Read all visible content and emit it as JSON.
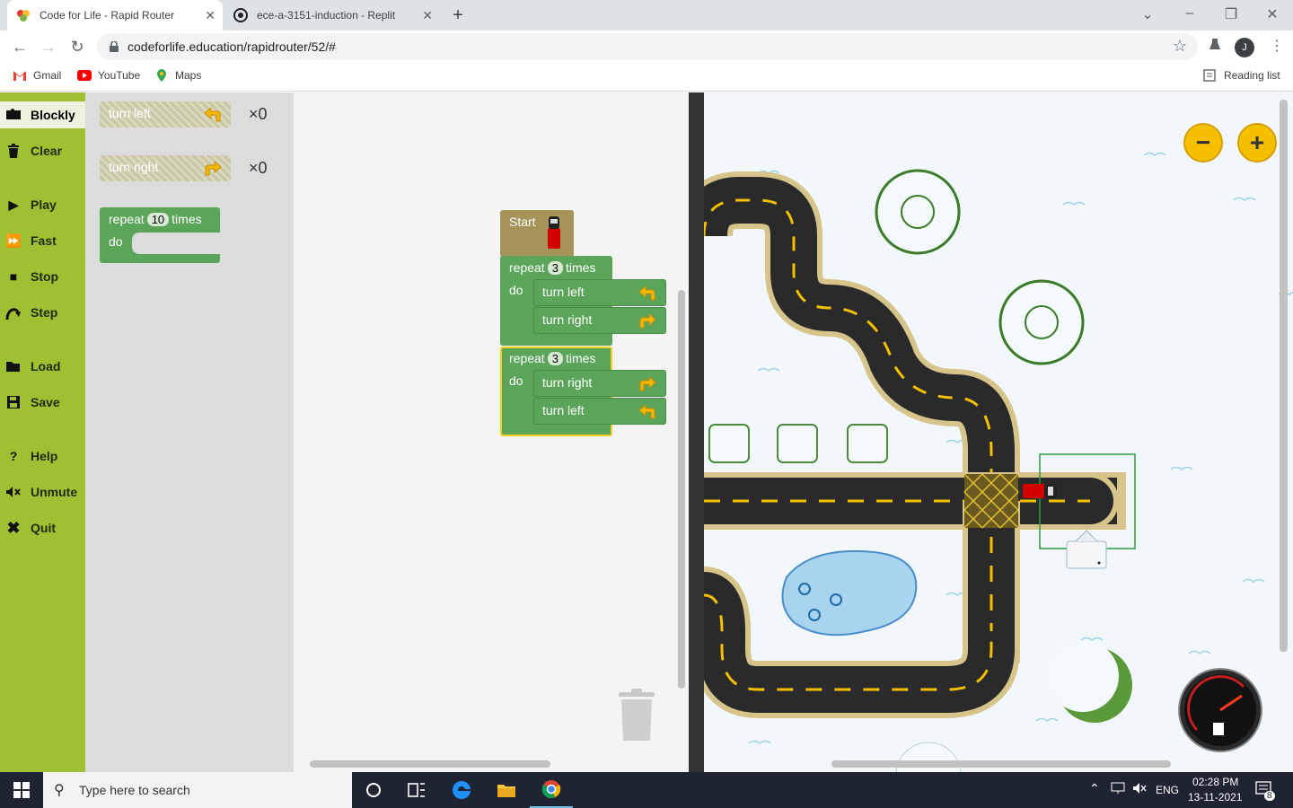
{
  "browser": {
    "tabs": [
      {
        "title": "Code for Life - Rapid Router",
        "active": true
      },
      {
        "title": "ece-a-3151-induction - Replit",
        "active": false
      }
    ],
    "url": "codeforlife.education/rapidrouter/52/#",
    "avatar_letter": "J",
    "bookmarks": [
      "Gmail",
      "YouTube",
      "Maps"
    ],
    "reading_list": "Reading list"
  },
  "sidebar": {
    "items": [
      {
        "label": "Blockly",
        "icon": "puzzle-icon",
        "active": true
      },
      {
        "label": "Clear",
        "icon": "trash-icon"
      },
      {
        "label": "Play",
        "icon": "play-icon"
      },
      {
        "label": "Fast",
        "icon": "fast-forward-icon"
      },
      {
        "label": "Stop",
        "icon": "stop-icon"
      },
      {
        "label": "Step",
        "icon": "step-icon"
      },
      {
        "label": "Load",
        "icon": "folder-icon"
      },
      {
        "label": "Save",
        "icon": "save-icon"
      },
      {
        "label": "Help",
        "icon": "help-icon"
      },
      {
        "label": "Unmute",
        "icon": "speaker-muted-icon"
      },
      {
        "label": "Quit",
        "icon": "close-icon"
      }
    ]
  },
  "toolbox": {
    "turn_left": {
      "label": "turn left",
      "count": "×0"
    },
    "turn_right": {
      "label": "turn right",
      "count": "×0"
    },
    "repeat": {
      "label": "repeat",
      "value": "10",
      "suffix": "times",
      "do": "do"
    }
  },
  "workspace": {
    "start": {
      "label": "Start"
    },
    "repeat1": {
      "label": "repeat",
      "value": "3",
      "suffix": "times",
      "do": "do",
      "cmd1": "turn left",
      "cmd2": "turn right"
    },
    "repeat2": {
      "label": "repeat",
      "value": "3",
      "suffix": "times",
      "do": "do",
      "cmd1": "turn right",
      "cmd2": "turn left"
    }
  },
  "colors": {
    "sidebar": "#a0c034",
    "block_green": "#5ba55b",
    "block_disabled": "#c9c8a6",
    "start_block": "#a6945a",
    "zoom_button": "#f5c000"
  },
  "taskbar": {
    "search_placeholder": "Type here to search",
    "lang": "ENG",
    "time": "02:28 PM",
    "date": "13-11-2021",
    "notif_count": "8"
  }
}
